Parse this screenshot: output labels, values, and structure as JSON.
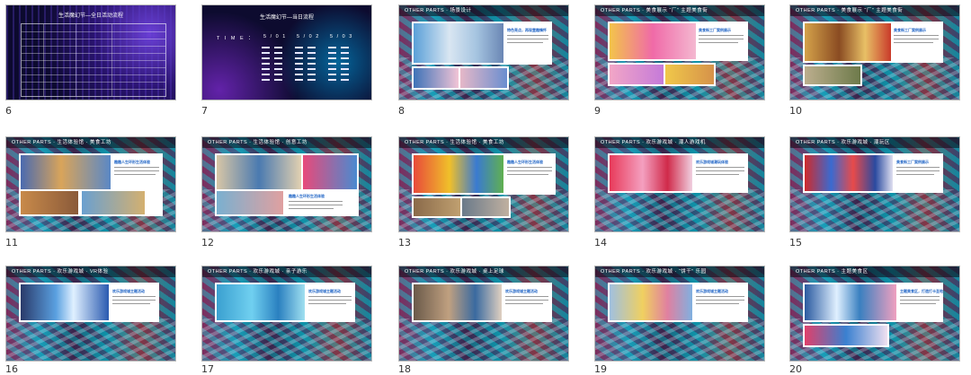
{
  "slides": [
    {
      "number": "6",
      "title": "生活魔幻节—全日活动流程"
    },
    {
      "number": "7",
      "title": "生活魔幻节—当日流程",
      "time_label": "T I M E ：",
      "dates": [
        "5 / 0 1",
        "5 / 0 2",
        "5 / 0 3"
      ]
    },
    {
      "number": "8",
      "header": "OTHER PARTS  ·  场景设计",
      "heading": "特色亮点，再现童趣情怀"
    },
    {
      "number": "9",
      "header": "OTHER PARTS  ·  美食展示 “厂” 主题美食街",
      "heading": "美食街工厂案例展示"
    },
    {
      "number": "10",
      "header": "OTHER PARTS  ·  美食展示 “厂” 主题美食街",
      "heading": "美食街工厂案例展示"
    },
    {
      "number": "11",
      "header": "OTHER PARTS  ·  生活体验馆 · 美食工坊",
      "heading": "趣趣人生环形生活体验"
    },
    {
      "number": "12",
      "header": "OTHER PARTS  ·  生活体验馆 · 创意工坊",
      "heading": "趣趣人生环形生活体验"
    },
    {
      "number": "13",
      "header": "OTHER PARTS  ·  生活体验馆 · 美食工坊",
      "heading": "趣趣人生环形生活体验"
    },
    {
      "number": "14",
      "header": "OTHER PARTS  ·  欢乐游戏城 · 潮人游戏机",
      "heading": "欢乐游戏城潮玩体验"
    },
    {
      "number": "15",
      "header": "OTHER PARTS  ·  欢乐游戏城 · 潮玩区",
      "heading": "美食街工厂案例展示"
    },
    {
      "number": "16",
      "header": "OTHER PARTS  ·  欢乐游戏城 · VR体验",
      "heading": "欢乐游戏城主题活动"
    },
    {
      "number": "17",
      "header": "OTHER PARTS  ·  欢乐游戏城 · 亲子游乐",
      "heading": "欢乐游戏城主题活动"
    },
    {
      "number": "18",
      "header": "OTHER PARTS  ·  欢乐游戏城 · 桌上足球",
      "heading": "欢乐游戏城主题活动"
    },
    {
      "number": "19",
      "header": "OTHER PARTS  ·  欢乐游戏城 · “饼干” 乐园",
      "heading": "欢乐游戏城主题活动"
    },
    {
      "number": "20",
      "header": "OTHER PARTS  ·  主题美食区",
      "heading": "主题美食区，打造打卡圣地"
    }
  ],
  "colors": {
    "accent": "#1f64c6",
    "dark_bg": "#0d0b2f",
    "border": "#b9b9b9"
  }
}
